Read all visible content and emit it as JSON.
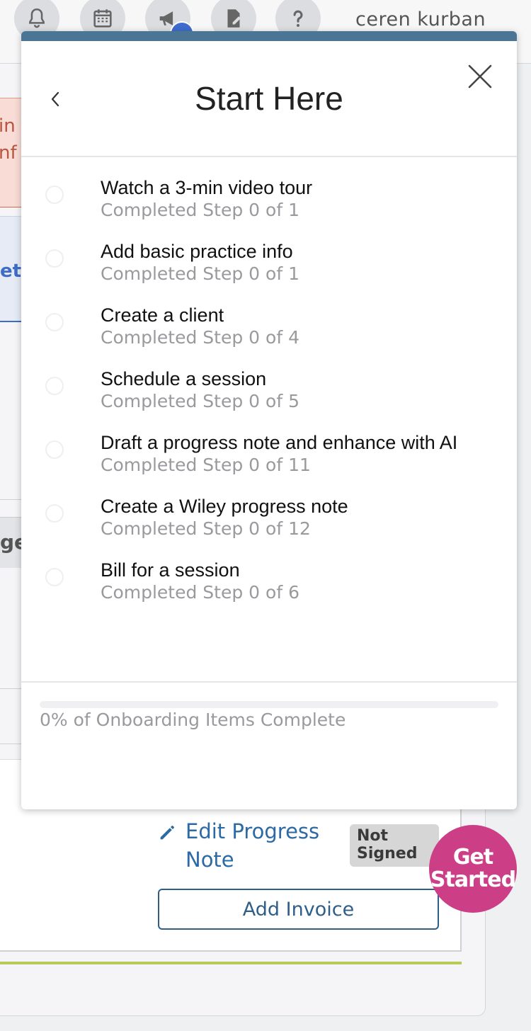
{
  "header": {
    "user_name": "ceren kurban",
    "icons": [
      "bell-icon",
      "calendar-icon",
      "megaphone-icon",
      "document-edit-icon",
      "help-icon"
    ]
  },
  "background": {
    "alert_text_line1": "in",
    "alert_text_line2": "nf",
    "blue_text": "et",
    "gray_text": "ge",
    "edit_progress_note_label": "Edit Progress Note",
    "not_signed_label": "Not Signed",
    "add_invoice_label": "Add Invoice",
    "get_started_label_line1": "Get",
    "get_started_label_line2": "Started",
    "get_started_color": "#cc3f86"
  },
  "modal": {
    "title": "Start Here",
    "accent_color": "#4a7595",
    "steps": [
      {
        "title": "Watch a 3-min video tour",
        "status": "Completed Step 0 of 1"
      },
      {
        "title": "Add basic practice info",
        "status": "Completed Step 0 of 1"
      },
      {
        "title": "Create a client",
        "status": "Completed Step 0 of 4"
      },
      {
        "title": "Schedule a session",
        "status": "Completed Step 0 of 5"
      },
      {
        "title": "Draft a progress note and enhance with AI",
        "status": "Completed Step 0 of 11"
      },
      {
        "title": "Create a Wiley progress note",
        "status": "Completed Step 0 of 12"
      },
      {
        "title": "Bill for a session",
        "status": "Completed Step 0 of 6"
      }
    ],
    "progress_percent": 0,
    "progress_label": "0% of Onboarding Items Complete"
  }
}
